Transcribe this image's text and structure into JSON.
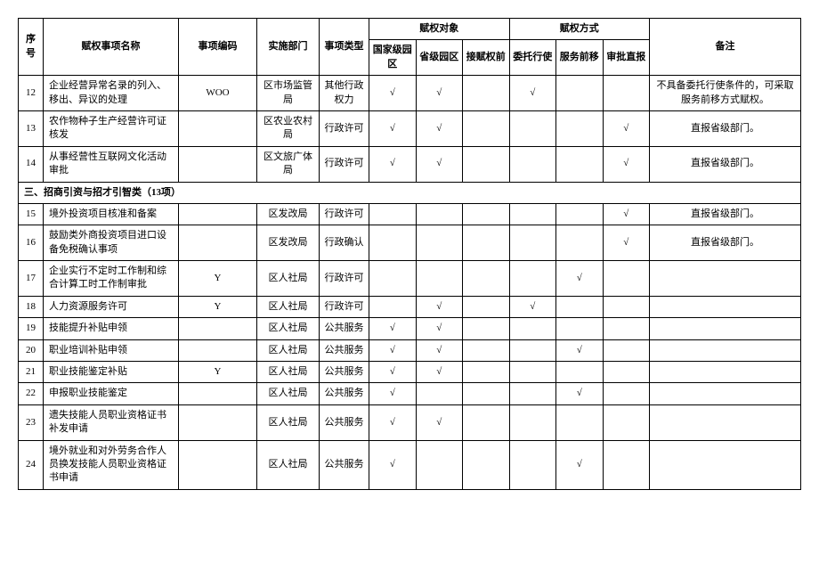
{
  "headers": {
    "seq": "序号",
    "name": "赋权事项名称",
    "code": "事项编码",
    "dept": "实施部门",
    "type": "事项类型",
    "obj_group": "赋权对象",
    "method_group": "赋权方式",
    "note": "备注",
    "obj1": "国家级园区",
    "obj2": "省级园区",
    "obj3": "接赋权前",
    "m1": "委托行使",
    "m2": "服务前移",
    "m3": "审批直报"
  },
  "section": "三、招商引资与招才引智类（13项）",
  "rows": [
    {
      "seq": "12",
      "name": "企业经营异常名录的列入、移出、异议的处理",
      "code": "WOO",
      "dept": "区市场监管局",
      "type": "其他行政权力",
      "obj1": "√",
      "obj2": "√",
      "obj3": "",
      "m1": "√",
      "m2": "",
      "m3": "",
      "note": "不具备委托行使条件的，可采取服务前移方式赋权。"
    },
    {
      "seq": "13",
      "name": "农作物种子生产经营许可证核发",
      "code": "",
      "dept": "区农业农村局",
      "type": "行政许可",
      "obj1": "√",
      "obj2": "√",
      "obj3": "",
      "m1": "",
      "m2": "",
      "m3": "√",
      "note": "直报省级部门。"
    },
    {
      "seq": "14",
      "name": "从事经营性互联网文化活动审批",
      "code": "",
      "dept": "区文旅广体局",
      "type": "行政许可",
      "obj1": "√",
      "obj2": "√",
      "obj3": "",
      "m1": "",
      "m2": "",
      "m3": "√",
      "note": "直报省级部门。"
    },
    {
      "seq": "15",
      "name": "境外投资项目核准和备案",
      "code": "",
      "dept": "区发改局",
      "type": "行政许可",
      "obj1": "",
      "obj2": "",
      "obj3": "",
      "m1": "",
      "m2": "",
      "m3": "√",
      "note": "直报省级部门。"
    },
    {
      "seq": "16",
      "name": "鼓励类外商投资项目进口设备免税确认事项",
      "code": "",
      "dept": "区发改局",
      "type": "行政确认",
      "obj1": "",
      "obj2": "",
      "obj3": "",
      "m1": "",
      "m2": "",
      "m3": "√",
      "note": "直报省级部门。"
    },
    {
      "seq": "17",
      "name": "企业实行不定时工作制和综合计算工时工作制审批",
      "code": "Y",
      "dept": "区人社局",
      "type": "行政许可",
      "obj1": "",
      "obj2": "",
      "obj3": "",
      "m1": "",
      "m2": "√",
      "m3": "",
      "note": ""
    },
    {
      "seq": "18",
      "name": "人力资源服务许可",
      "code": "Y",
      "dept": "区人社局",
      "type": "行政许可",
      "obj1": "",
      "obj2": "√",
      "obj3": "",
      "m1": "√",
      "m2": "",
      "m3": "",
      "note": ""
    },
    {
      "seq": "19",
      "name": "技能提升补贴申领",
      "code": "",
      "dept": "区人社局",
      "type": "公共服务",
      "obj1": "√",
      "obj2": "√",
      "obj3": "",
      "m1": "",
      "m2": "",
      "m3": "",
      "note": ""
    },
    {
      "seq": "20",
      "name": "职业培训补贴申领",
      "code": "",
      "dept": "区人社局",
      "type": "公共服务",
      "obj1": "√",
      "obj2": "√",
      "obj3": "",
      "m1": "",
      "m2": "√",
      "m3": "",
      "note": ""
    },
    {
      "seq": "21",
      "name": "职业技能鉴定补贴",
      "code": "Y",
      "dept": "区人社局",
      "type": "公共服务",
      "obj1": "√",
      "obj2": "√",
      "obj3": "",
      "m1": "",
      "m2": "",
      "m3": "",
      "note": ""
    },
    {
      "seq": "22",
      "name": "申报职业技能鉴定",
      "code": "",
      "dept": "区人社局",
      "type": "公共服务",
      "obj1": "√",
      "obj2": "",
      "obj3": "",
      "m1": "",
      "m2": "√",
      "m3": "",
      "note": ""
    },
    {
      "seq": "23",
      "name": "遗失技能人员职业资格证书补发申请",
      "code": "",
      "dept": "区人社局",
      "type": "公共服务",
      "obj1": "√",
      "obj2": "√",
      "obj3": "",
      "m1": "",
      "m2": "",
      "m3": "",
      "note": ""
    },
    {
      "seq": "24",
      "name": "境外就业和对外劳务合作人员换发技能人员职业资格证书申请",
      "code": "",
      "dept": "区人社局",
      "type": "公共服务",
      "obj1": "√",
      "obj2": "",
      "obj3": "",
      "m1": "",
      "m2": "√",
      "m3": "",
      "note": ""
    }
  ]
}
